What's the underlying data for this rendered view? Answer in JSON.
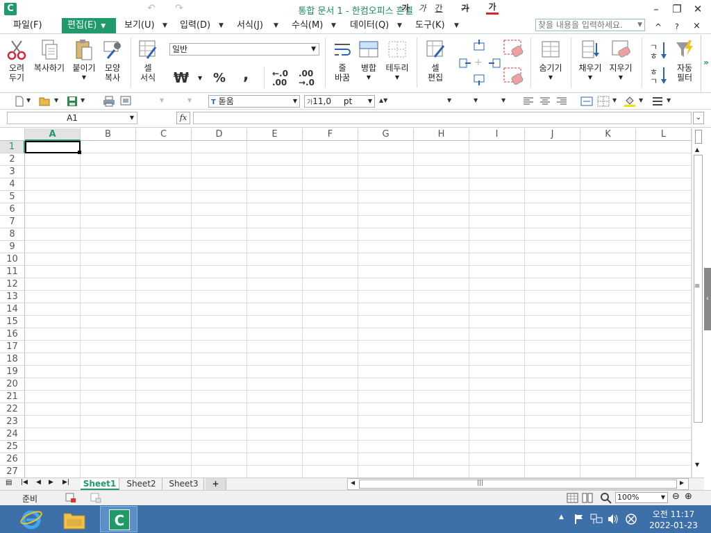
{
  "window": {
    "logo": "C",
    "title": "통합 문서 1 - 한컴오피스 흔셀",
    "min": "–",
    "restore": "❐",
    "close": "✕"
  },
  "menu": {
    "items": [
      {
        "label": "파일(F)"
      },
      {
        "label": "편집(E)"
      },
      {
        "label": "보기(U)"
      },
      {
        "label": "입력(D)"
      },
      {
        "label": "서식(J)"
      },
      {
        "label": "수식(M)"
      },
      {
        "label": "데이터(Q)"
      },
      {
        "label": "도구(K)"
      }
    ],
    "search_placeholder": "찾을 내용을 입력하세요.",
    "caret": "^",
    "help": "?",
    "close": "×"
  },
  "ribbon": {
    "cut": "오려\n두기",
    "copy": "복사하기",
    "paste": "붙이기",
    "format_painter": "모양\n복사",
    "cell_format": "셀\n서식",
    "number_format": "일반",
    "currency": "₩",
    "percent": "%",
    "comma": ",",
    "inc_dec": "←.0\n.00",
    "dec_dec": ".00\n→.0",
    "wrap": "줄\n바꿈",
    "merge": "병합",
    "border": "테두리",
    "cell_edit": "셀\n편집",
    "hide": "숨기기",
    "fill": "채우기",
    "clear": "지우기",
    "autofilter": "자동\n필터",
    "more": "»"
  },
  "toolbar2": {
    "font": "돋움",
    "size": "11,0",
    "unit": "pt",
    "bold": "가",
    "italic": "가",
    "underline": "간",
    "strike": "가",
    "color": "가"
  },
  "formula_bar": {
    "name_box": "A1",
    "fx": "fx",
    "value": ""
  },
  "grid": {
    "columns": [
      "A",
      "B",
      "C",
      "D",
      "E",
      "F",
      "G",
      "H",
      "I",
      "J",
      "K",
      "L"
    ],
    "rows": [
      "1",
      "2",
      "3",
      "4",
      "5",
      "6",
      "7",
      "8",
      "9",
      "10",
      "11",
      "12",
      "13",
      "14",
      "15",
      "16",
      "17",
      "18",
      "19",
      "20",
      "21",
      "22",
      "23",
      "24",
      "25",
      "26",
      "27"
    ],
    "active_cell": "A1"
  },
  "sheets": {
    "tabs": [
      "Sheet1",
      "Sheet2",
      "Sheet3"
    ],
    "add": "+",
    "active": "Sheet1"
  },
  "status": {
    "text": "준비",
    "zoom": "100%"
  },
  "taskbar": {
    "time": "오전 11:17",
    "date": "2022-01-23"
  },
  "colors": {
    "accent": "#1f9a6a",
    "taskbar": "#3d6fa8"
  }
}
